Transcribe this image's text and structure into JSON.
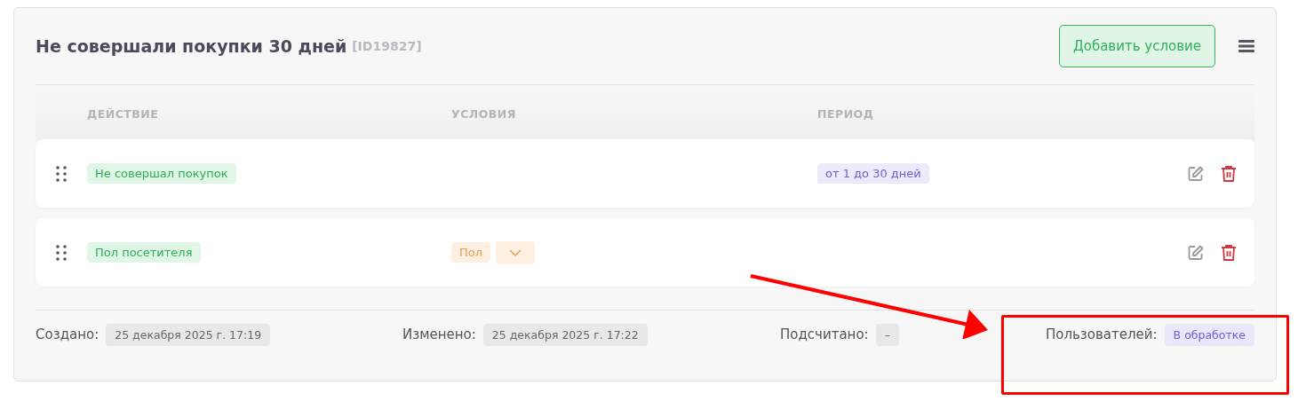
{
  "segment": {
    "title": "Не совершали покупки 30 дней",
    "id_label": "[ID19827]",
    "add_button": "Добавить условие"
  },
  "table": {
    "columns": [
      "ДЕЙСТВИЕ",
      "УСЛОВИЯ",
      "ПЕРИОД"
    ],
    "rows": [
      {
        "action": "Не совершал покупок",
        "conditions": [],
        "period": "от 1 до 30 дней"
      },
      {
        "action": "Пол посетителя",
        "conditions": [
          {
            "kind": "tag",
            "label": "Пол"
          },
          {
            "kind": "dropdown"
          }
        ]
      }
    ]
  },
  "footer": [
    {
      "label": "Создано:",
      "value": "25 декабря 2025 г. 17:19",
      "kind": "plain"
    },
    {
      "label": "Изменено:",
      "value": "25 декабря 2025 г. 17:22",
      "kind": "plain"
    },
    {
      "label": "Подсчитано:",
      "value": "–",
      "kind": "plain"
    },
    {
      "label": "Пользователей:",
      "value": "В обработке",
      "kind": "status"
    }
  ]
}
